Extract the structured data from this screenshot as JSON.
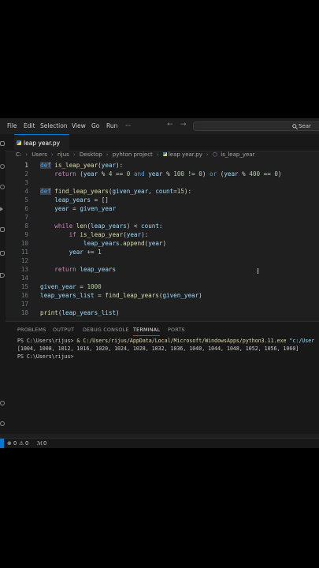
{
  "menu": [
    "File",
    "Edit",
    "Selection",
    "View",
    "Go",
    "Run",
    "···"
  ],
  "nav": {
    "back": "←",
    "forward": "→"
  },
  "command_center": {
    "text": "Sear",
    "icon": "search-icon"
  },
  "tab": {
    "label": "leap year.py"
  },
  "breadcrumb": [
    "C:",
    "Users",
    "rijus",
    "Desktop",
    "pyhton project",
    "leap year.py",
    "is_leap_year"
  ],
  "editor": {
    "line_numbers": [
      "1",
      "2",
      "3",
      "4",
      "5",
      "6",
      "7",
      "8",
      "9",
      "10",
      "11",
      "12",
      "13",
      "14",
      "15",
      "16",
      "17",
      "18"
    ],
    "current_line": 1
  },
  "panel": {
    "tabs": [
      "PROBLEMS",
      "OUTPUT",
      "DEBUG CONSOLE",
      "TERMINAL",
      "PORTS"
    ],
    "active_tab": "TERMINAL",
    "terminal": {
      "prompt1": "PS C:\\Users\\rijus> ",
      "amp": "& ",
      "exe": "C:/Users/rijus/AppData/Local/Microsoft/WindowsApps/python3.11.exe",
      "arg": " \"c:/User",
      "output": "[1004, 1008, 1012, 1016, 1020, 1024, 1028, 1032, 1036, 1040, 1044, 1048, 1052, 1056, 1060]",
      "prompt2": "PS C:\\Users\\rijus>"
    }
  },
  "status": {
    "errors": "0",
    "warnings": "0",
    "ports": "0"
  },
  "colors": {
    "accent": "#0078d4",
    "editor_bg": "#1f1f1f",
    "panel_bg": "#181818"
  }
}
